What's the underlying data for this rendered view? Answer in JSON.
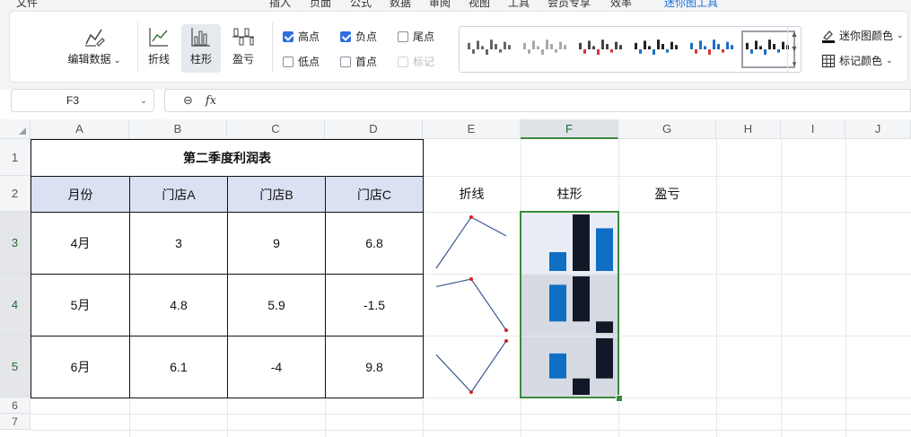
{
  "menubar": {
    "items": [
      "文件",
      "插入",
      "页面",
      "公式",
      "数据",
      "审阅",
      "视图",
      "工具",
      "会员专享",
      "效率",
      "迷你图工具"
    ]
  },
  "ribbon": {
    "edit_data": "编辑数据",
    "line": "折线",
    "column": "柱形",
    "winloss": "盈亏",
    "checks": {
      "high": {
        "label": "高点",
        "checked": true
      },
      "negative": {
        "label": "负点",
        "checked": true
      },
      "last": {
        "label": "尾点",
        "checked": false
      },
      "low": {
        "label": "低点",
        "checked": false
      },
      "first": {
        "label": "首点",
        "checked": false
      },
      "markers": {
        "label": "标记",
        "checked": false
      }
    },
    "sparkline_color": "迷你图颜色",
    "marker_color": "标记颜色"
  },
  "formula": {
    "name_box": "F3",
    "fx": "fx",
    "value": ""
  },
  "columns": [
    "A",
    "B",
    "C",
    "D",
    "E",
    "F",
    "G",
    "H",
    "I",
    "J"
  ],
  "rows": [
    "1",
    "2",
    "3",
    "4",
    "5",
    "6",
    "7"
  ],
  "sheet": {
    "title": "第二季度利润表",
    "headers": [
      "月份",
      "门店A",
      "门店B",
      "门店C"
    ],
    "sparkline_headers": [
      "折线",
      "柱形",
      "盈亏"
    ],
    "data": [
      {
        "month": "4月",
        "a": "3",
        "b": "9",
        "c": "6.8"
      },
      {
        "month": "5月",
        "a": "4.8",
        "b": "5.9",
        "c": "-1.5"
      },
      {
        "month": "6月",
        "a": "6.1",
        "b": "-4",
        "c": "9.8"
      }
    ]
  },
  "colors": {
    "accent": "#3c8a3c",
    "bar_blue": "#0e6fc4",
    "bar_dark": "#111827",
    "header_fill": "#d9e1f2",
    "marker": "#d42020",
    "line": "#3a5b8f"
  }
}
